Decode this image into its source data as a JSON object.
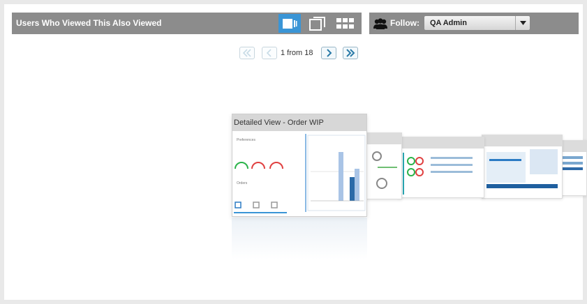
{
  "header": {
    "title": "Users Who Viewed This Also Viewed",
    "view_modes": [
      {
        "name": "carousel-view",
        "active": true
      },
      {
        "name": "cover-view",
        "active": false
      },
      {
        "name": "grid-view",
        "active": false
      }
    ]
  },
  "follow": {
    "label": "Follow:",
    "selected": "QA Admin"
  },
  "pager": {
    "text": "1 from 18"
  },
  "carousel": {
    "main_title": "Detailed View - Order WIP"
  },
  "colors": {
    "header_bg": "#8c8c8c",
    "active_view_bg": "#3a95d6",
    "accent": "#2b7bc4"
  }
}
